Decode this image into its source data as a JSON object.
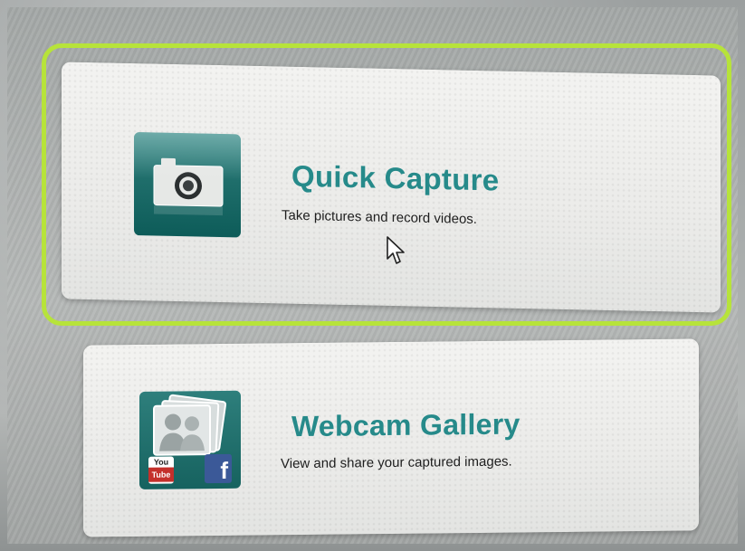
{
  "accent_color": "#268a8a",
  "highlight_color": "#b7e33a",
  "menu": {
    "items": [
      {
        "title": "Quick Capture",
        "description": "Take pictures and record videos.",
        "icon": "camera-icon",
        "selected": true
      },
      {
        "title": "Webcam Gallery",
        "description": "View and share your captured images.",
        "icon": "photo-gallery-icon",
        "badges": [
          {
            "icon": "youtube-icon",
            "text": "You Tube"
          },
          {
            "icon": "facebook-icon",
            "text": "f"
          }
        ],
        "selected": false
      }
    ]
  },
  "cursor": {
    "icon": "mouse-pointer-icon"
  }
}
